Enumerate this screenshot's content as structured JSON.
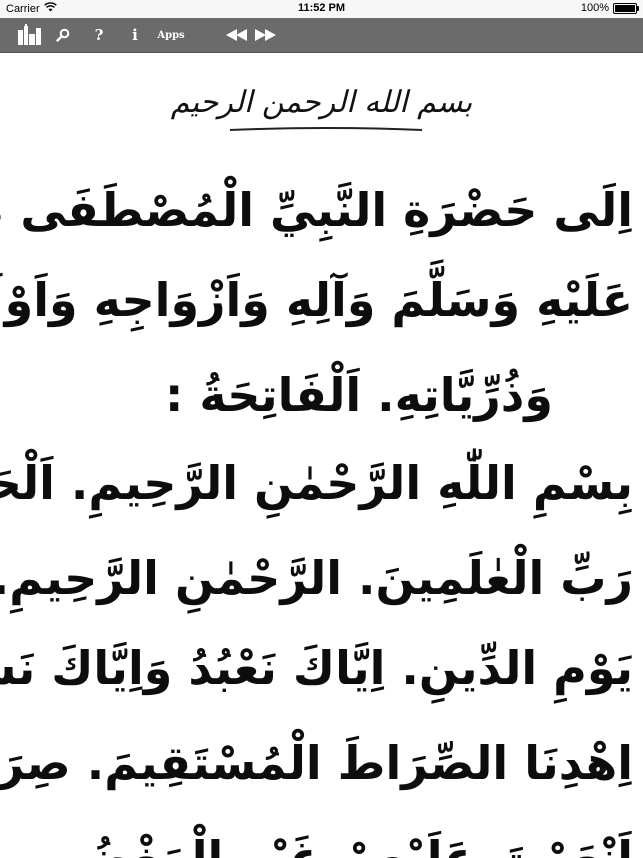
{
  "status_bar": {
    "carrier": "Carrier",
    "time": "11:52 PM",
    "battery": "100%",
    "battery_level": 1.0
  },
  "toolbar": {
    "help_label": "?",
    "info_label": "i",
    "apps_label": "Apps"
  },
  "page": {
    "header": "بسم الله الرحمن الرحيم",
    "lines": [
      "اِلَى حَضْرَةِ النَّبِيِّ الْمُصْطَفَى صَلَّى اللّٰهُ",
      "عَلَيْهِ وَسَلَّمَ وَآلِهِ وَاَزْوَاجِهِ وَاَوْلَادِهِ",
      "وَذُرِّيَّاتِهِ. اَلْفَاتِحَةُ :",
      "بِسْمِ اللّٰهِ الرَّحْمٰنِ الرَّحِيمِ. اَلْحَمْدُ لِلّٰهِ",
      "رَبِّ الْعٰلَمِينَ. الرَّحْمٰنِ الرَّحِيمِ. مٰلِكِ",
      "يَوْمِ الدِّينِ. اِيَّاكَ نَعْبُدُ وَاِيَّاكَ نَسْتَعِينُ.",
      "اِهْدِنَا الصِّرَاطَ الْمُسْتَقِيمَ. صِرَاطَ الَّذِينَ",
      "اَنْعَمْتَ عَلَيْهِمْ غَيْرِ الْمَغْضُوبِ"
    ]
  }
}
